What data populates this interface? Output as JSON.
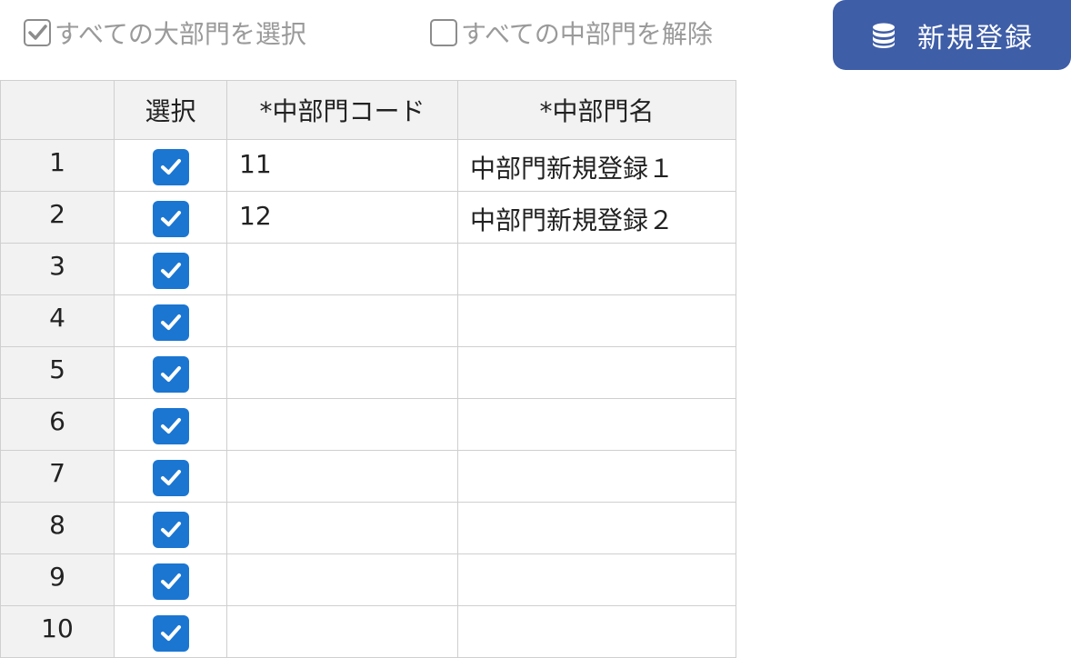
{
  "toolbar": {
    "select_all_label": "すべての大部門を選択",
    "select_all_checked": true,
    "deselect_all_label": "すべての中部門を解除",
    "deselect_all_checked": false,
    "register_label": "新規登録",
    "register_icon": "database-icon",
    "register_color": "#3f5ea8"
  },
  "table": {
    "headers": [
      "",
      "選択",
      "*中部門コード",
      "*中部門名"
    ],
    "rows": [
      {
        "num": "1",
        "selected": true,
        "code": "11",
        "name": "中部門新規登録１"
      },
      {
        "num": "2",
        "selected": true,
        "code": "12",
        "name": "中部門新規登録２"
      },
      {
        "num": "3",
        "selected": true,
        "code": "",
        "name": ""
      },
      {
        "num": "4",
        "selected": true,
        "code": "",
        "name": ""
      },
      {
        "num": "5",
        "selected": true,
        "code": "",
        "name": ""
      },
      {
        "num": "6",
        "selected": true,
        "code": "",
        "name": ""
      },
      {
        "num": "7",
        "selected": true,
        "code": "",
        "name": ""
      },
      {
        "num": "8",
        "selected": true,
        "code": "",
        "name": ""
      },
      {
        "num": "9",
        "selected": true,
        "code": "",
        "name": ""
      },
      {
        "num": "10",
        "selected": true,
        "code": "",
        "name": ""
      }
    ],
    "checkbox_color": "#1b76d2"
  }
}
